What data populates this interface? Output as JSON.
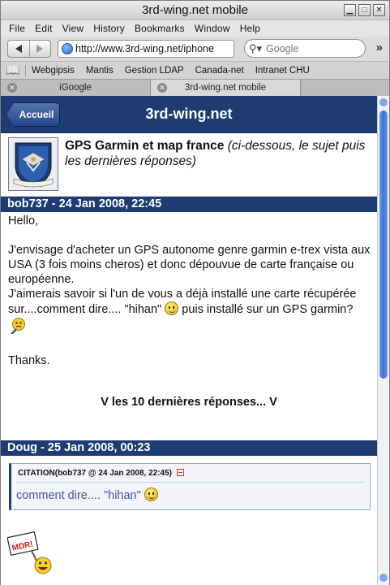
{
  "window": {
    "title": "3rd-wing.net mobile"
  },
  "menu": [
    "File",
    "Edit",
    "View",
    "History",
    "Bookmarks",
    "Window",
    "Help"
  ],
  "toolbar": {
    "url": "http://www.3rd-wing.net/iphone",
    "search_placeholder": "Google"
  },
  "bookmarks": [
    "Webgipsis",
    "Mantis",
    "Gestion LDAP",
    "Canada-net",
    "Intranet CHU"
  ],
  "tabs": [
    {
      "label": "iGoogle"
    },
    {
      "label": "3rd-wing.net mobile"
    }
  ],
  "site": {
    "back_label": "Accueil",
    "title": "3rd-wing.net"
  },
  "topic": {
    "title": "GPS Garmin et map france",
    "subtitle": "(ci-dessous, le sujet puis les dernières réponses)"
  },
  "post1": {
    "header": "bob737 - 24 Jan 2008, 22:45",
    "greeting": "Hello,",
    "para1": "J'envisage d'acheter un GPS autonome genre garmin e-trex vista aux USA (3 fois moins cheros) et donc dépouvue de carte française ou européenne.",
    "para2a": "J'aimerais savoir si l'un de vous a déjà installé une carte récupérée sur....comment dire.... \"hihan\"",
    "para2b": "puis installé sur un GPS garmin?",
    "closing": "Thanks."
  },
  "more_replies": "V les 10 dernières réponses... V",
  "post2": {
    "header": "Doug - 25 Jan 2008, 00:23",
    "quote_header": "CITATION(bob737 @ 24 Jan 2008, 22:45)",
    "quote_text": "comment dire.... \"hihan\"",
    "sign_text": "MDR!"
  }
}
